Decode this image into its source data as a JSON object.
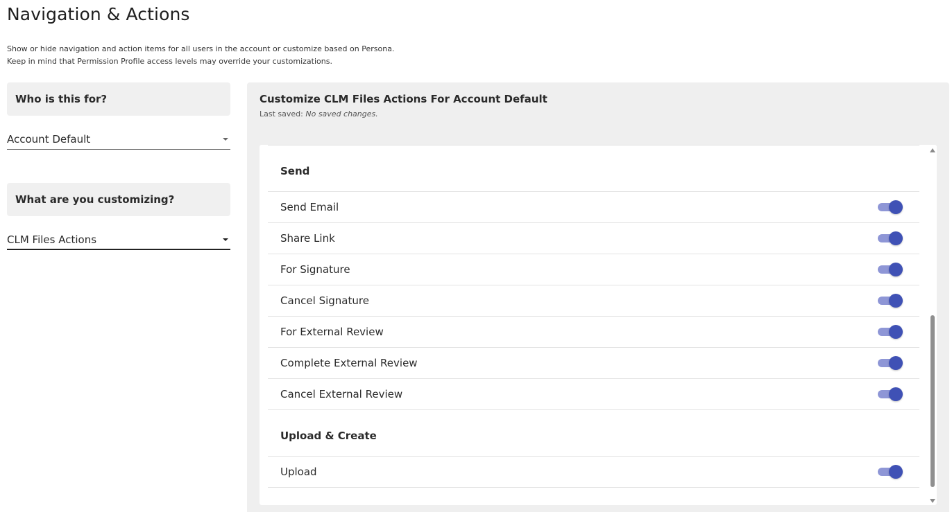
{
  "page": {
    "title": "Navigation & Actions",
    "description_line1": "Show or hide navigation and action items for all users in the account or customize based on Persona.",
    "description_line2": "Keep in mind that Permission Profile access levels may override your customizations."
  },
  "left": {
    "who_label": "Who is this for?",
    "who_value": "Account Default",
    "what_label": "What are you customizing?",
    "what_value": "CLM Files Actions"
  },
  "panel": {
    "title": "Customize CLM Files Actions For Account Default",
    "last_saved_label": "Last saved:",
    "last_saved_value": "No saved changes."
  },
  "sections": [
    {
      "header": "Send",
      "items": [
        {
          "label": "Send Email",
          "enabled": true
        },
        {
          "label": "Share Link",
          "enabled": true
        },
        {
          "label": "For Signature",
          "enabled": true
        },
        {
          "label": "Cancel Signature",
          "enabled": true
        },
        {
          "label": "For External Review",
          "enabled": true
        },
        {
          "label": "Complete External Review",
          "enabled": true
        },
        {
          "label": "Cancel External Review",
          "enabled": true
        }
      ]
    },
    {
      "header": "Upload & Create",
      "items": [
        {
          "label": "Upload",
          "enabled": true
        }
      ]
    }
  ],
  "colors": {
    "toggle_knob": "#3f51b5",
    "toggle_track": "#8e96d6",
    "panel_bg": "#efefef"
  },
  "icons": {
    "select_caret": "caret-down-icon",
    "scroll_up": "scroll-up-arrow-icon",
    "scroll_down": "scroll-down-arrow-icon"
  }
}
